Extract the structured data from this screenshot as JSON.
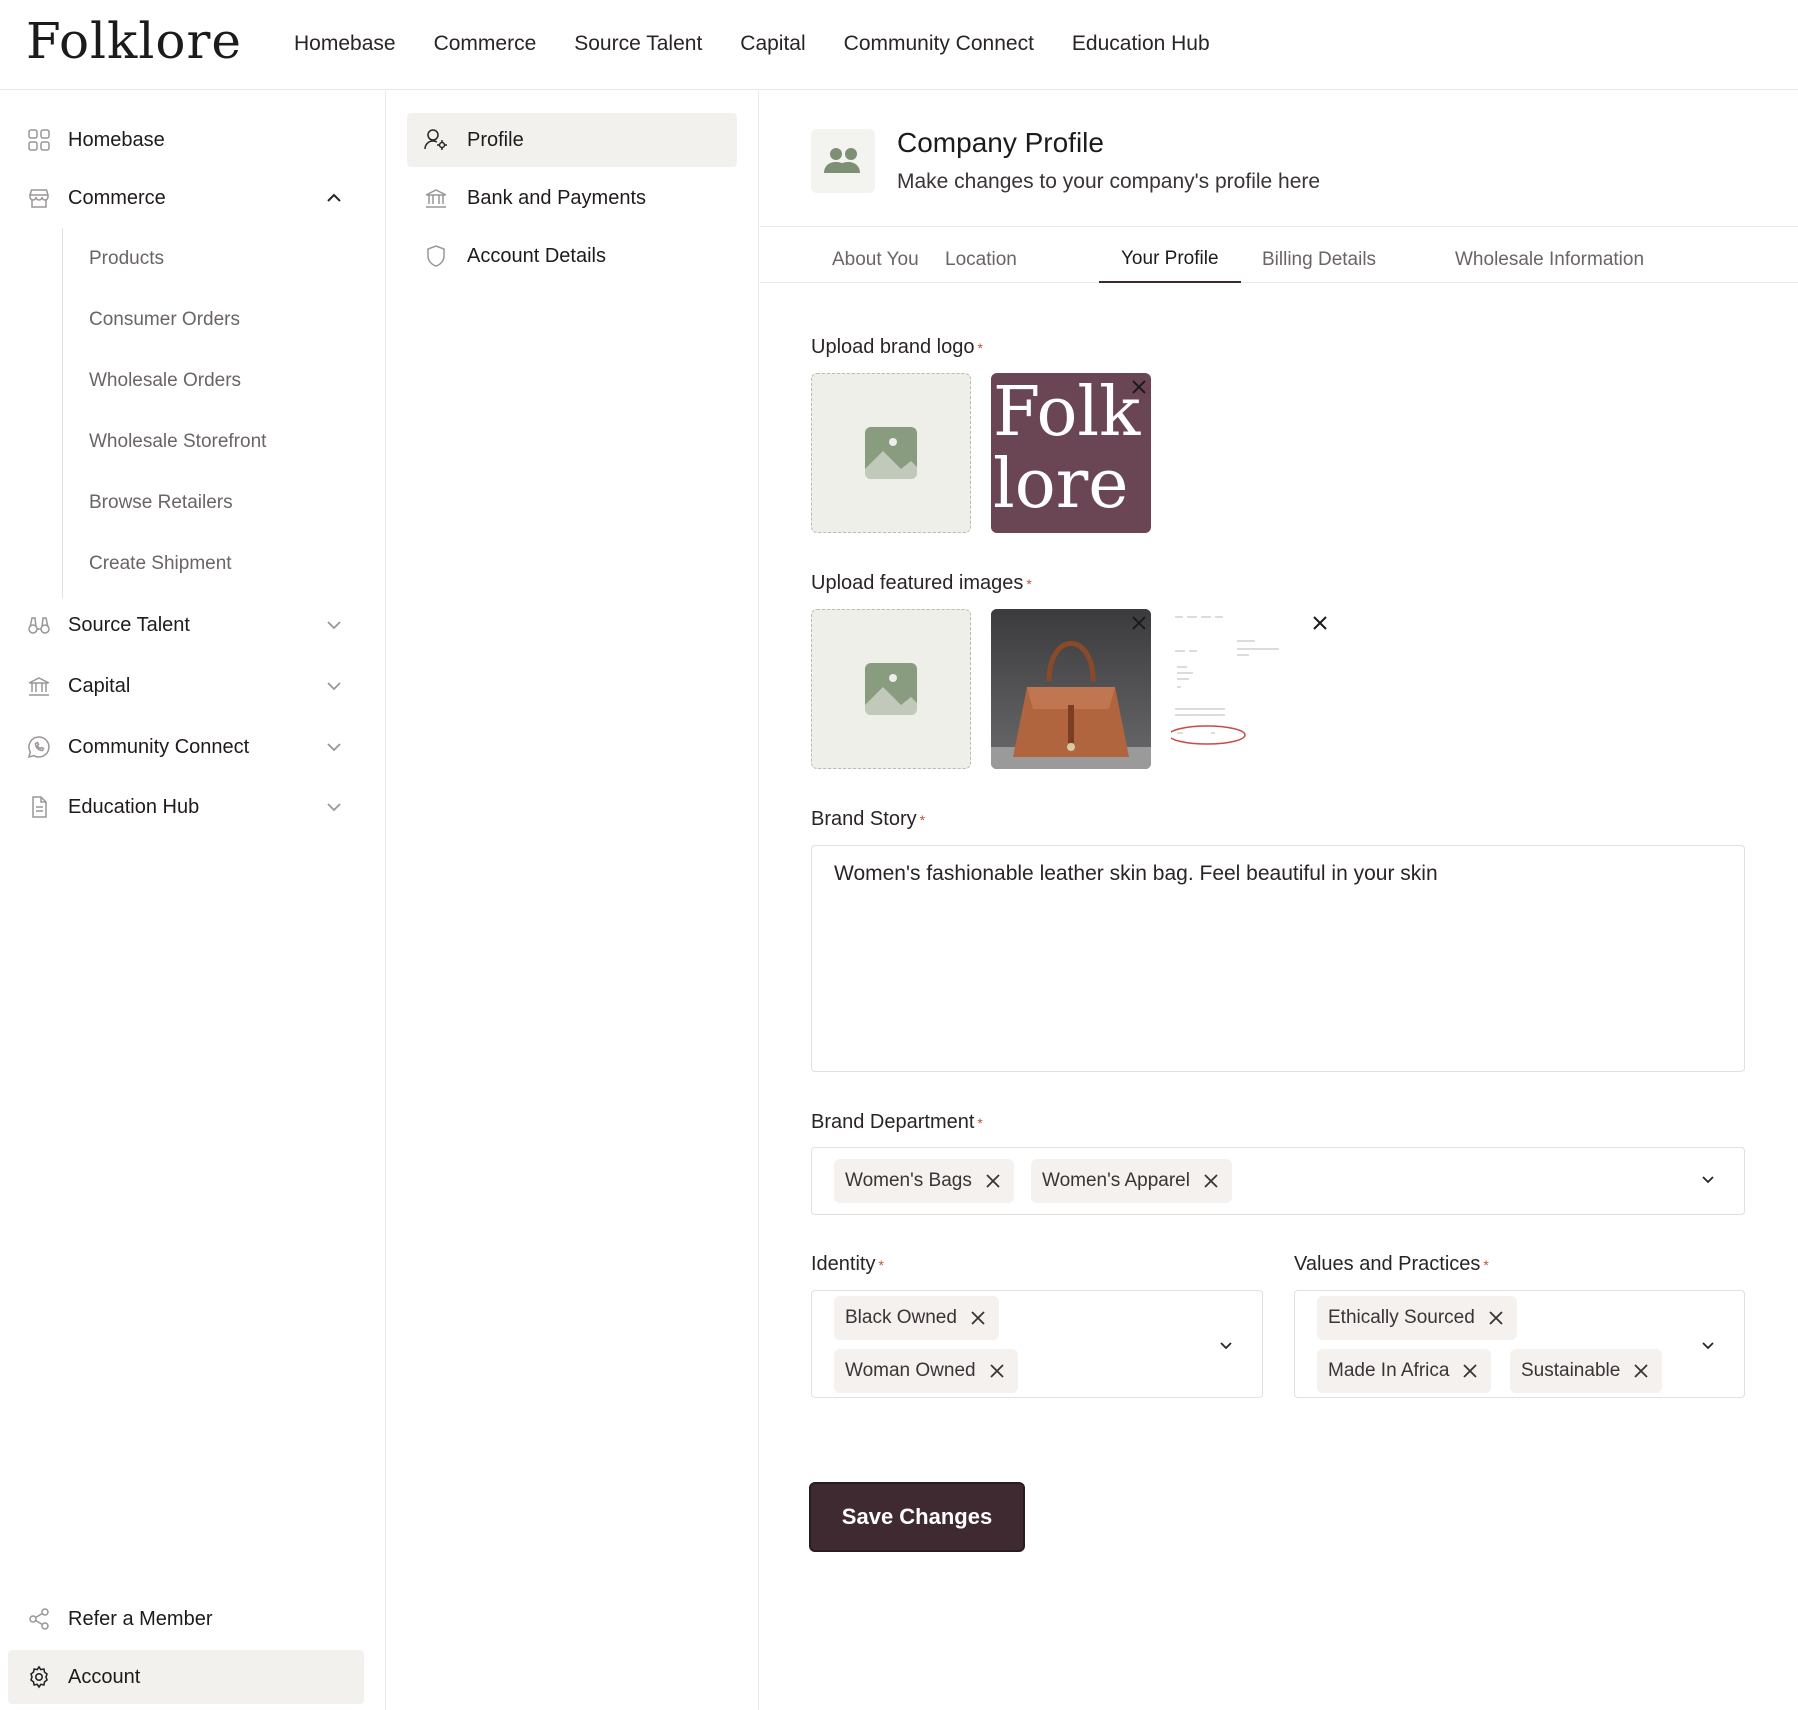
{
  "brand": {
    "logo_text": "Folklore"
  },
  "top_nav": [
    "Homebase",
    "Commerce",
    "Source Talent",
    "Capital",
    "Community Connect",
    "Education Hub"
  ],
  "sidebar": {
    "homebase": "Homebase",
    "commerce": "Commerce",
    "commerce_sub": [
      "Products",
      "Consumer Orders",
      "Wholesale Orders",
      "Wholesale Storefront",
      "Browse Retailers",
      "Create Shipment"
    ],
    "source_talent": "Source Talent",
    "capital": "Capital",
    "community_connect": "Community Connect",
    "education_hub": "Education Hub",
    "refer": "Refer a Member",
    "account": "Account"
  },
  "settings_nav": {
    "profile": "Profile",
    "bank": "Bank and Payments",
    "account_details": "Account Details"
  },
  "header": {
    "title": "Company Profile",
    "subtitle": "Make changes to your company's profile here"
  },
  "tabs": [
    "About You",
    "Location",
    "Your Profile",
    "Billing Details",
    "Wholesale Information"
  ],
  "active_tab": "Your Profile",
  "form": {
    "logo_label": "Upload brand logo",
    "featured_label": "Upload featured images",
    "story_label": "Brand Story",
    "story_value": "Women's fashionable  leather skin bag. Feel beautiful in your skin",
    "department_label": "Brand Department",
    "department_chips": [
      "Women's Bags",
      "Women's Apparel"
    ],
    "identity_label": "Identity",
    "identity_chips": [
      "Black Owned",
      "Woman Owned"
    ],
    "values_label": "Values and Practices",
    "values_chips": [
      "Ethically Sourced",
      "Made In Africa",
      "Sustainable"
    ],
    "required_mark": "*",
    "logo_thumb_text_1": "Folk",
    "logo_thumb_text_2": "lore"
  },
  "save_label": "Save Changes",
  "colors": {
    "accent": "#3f2a31",
    "logo_bg": "#6a4654",
    "placeholder_icon": "#8a9c80"
  }
}
